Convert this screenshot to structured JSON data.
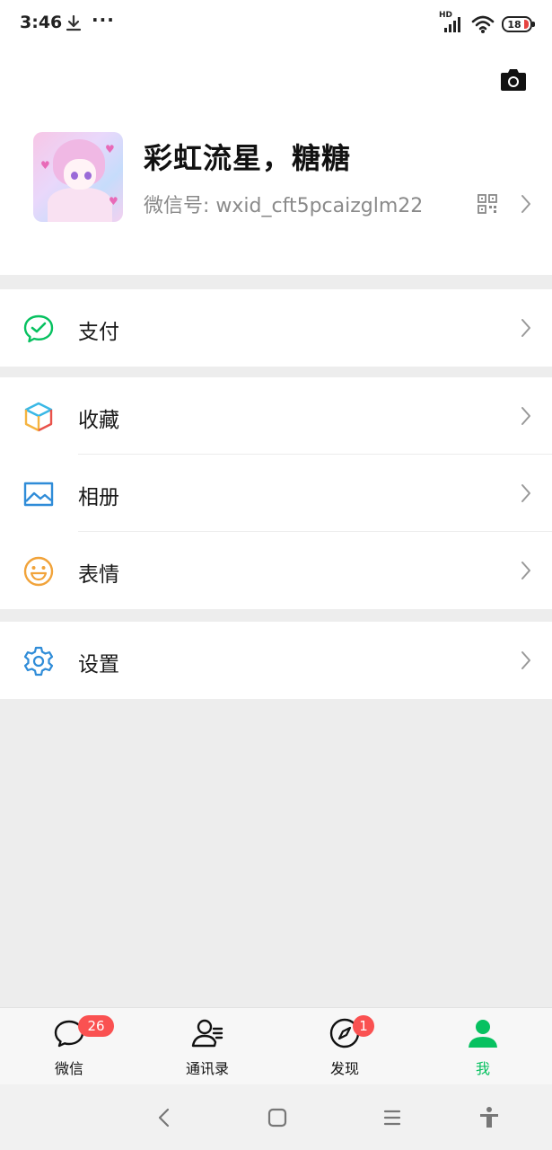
{
  "status_bar": {
    "time": "3:46",
    "more": "···",
    "network": "HD",
    "battery": "18"
  },
  "profile": {
    "nickname": "彩虹流星，糖糖",
    "wechat_id": "微信号: wxid_cft5pcaizglm22"
  },
  "menu": {
    "pay": "支付",
    "favorites": "收藏",
    "album": "相册",
    "stickers": "表情",
    "settings": "设置"
  },
  "tabbar": {
    "chats": {
      "label": "微信",
      "badge": "26"
    },
    "contacts": {
      "label": "通讯录"
    },
    "discover": {
      "label": "发现",
      "badge": "1"
    },
    "me": {
      "label": "我"
    }
  },
  "colors": {
    "accent": "#07c160",
    "badge": "#fa5151",
    "background": "#ededed"
  },
  "icons": [
    "download-icon",
    "signal-icon",
    "wifi-icon",
    "battery-icon",
    "camera-icon",
    "qr-code-icon",
    "chevron-right-icon",
    "pay-icon",
    "favorites-icon",
    "album-icon",
    "stickers-icon",
    "settings-icon",
    "chat-icon",
    "contacts-icon",
    "discover-icon",
    "me-icon",
    "back-icon",
    "home-icon",
    "menu-icon",
    "accessibility-icon"
  ]
}
